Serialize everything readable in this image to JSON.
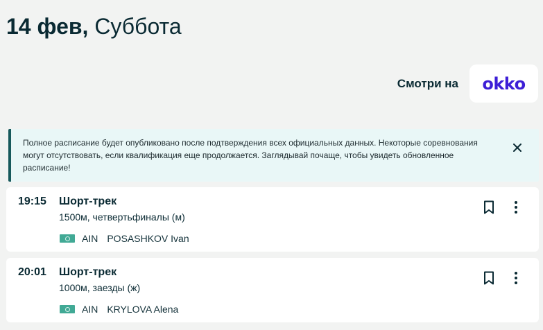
{
  "header": {
    "day": "14 фев,",
    "weekday": "Суббота"
  },
  "watch": {
    "label": "Смотри на",
    "provider": "okko"
  },
  "notice": {
    "text": "Полное расписание будет опубликовано после подтверждения всех официальных данных. Некоторые соревнования могут отсутствовать, если квалификация еще продолжается. Заглядывай почаще, чтобы увидеть обновленное расписание!",
    "close_icon": "close-icon"
  },
  "events": [
    {
      "time": "19:15",
      "sport": "Шорт-трек",
      "event": "1500м, четвертьфиналы (м)",
      "country": "AIN",
      "athlete": "POSASHKOV Ivan",
      "icons": [
        "bookmark-icon",
        "more-vertical-icon"
      ]
    },
    {
      "time": "20:01",
      "sport": "Шорт-трек",
      "event": "1000м, заезды (ж)",
      "country": "AIN",
      "athlete": "KRYLOVA Alena",
      "icons": [
        "bookmark-icon",
        "more-vertical-icon"
      ]
    }
  ],
  "colors": {
    "background": "#f2f3f2",
    "text": "#0a2a33",
    "notice_bg": "#e9f7f7",
    "notice_border": "#17595c",
    "flag": "#41a995",
    "okko": "#3d1fd6"
  }
}
